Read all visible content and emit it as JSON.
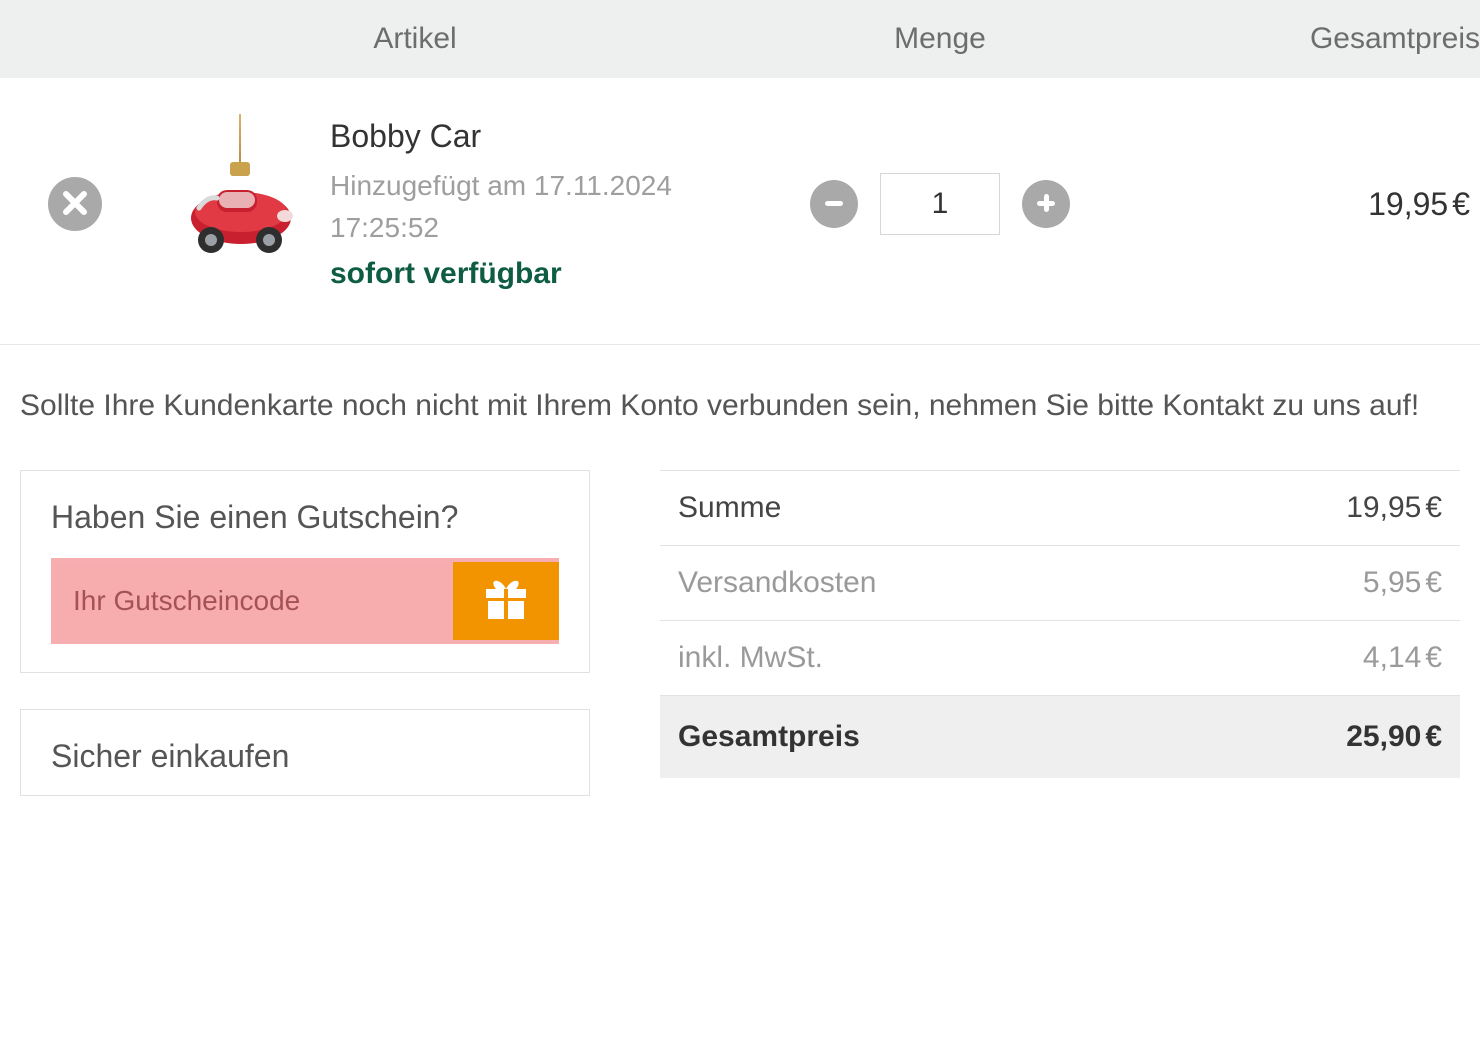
{
  "headers": {
    "article": "Artikel",
    "qty": "Menge",
    "total": "Gesamtpreis"
  },
  "item": {
    "name": "Bobby Car",
    "added_label": "Hinzugefügt am 17.11.2024 17:25:52",
    "availability": "sofort verfügbar",
    "quantity": "1",
    "line_price": "19,95",
    "currency": "€"
  },
  "notice": "Sollte Ihre Kundenkarte noch nicht mit Ihrem Konto verbunden sein, nehmen Sie bitte Kontakt zu uns auf!",
  "coupon": {
    "title": "Haben Sie einen Gutschein?",
    "placeholder": "Ihr Gutscheincode"
  },
  "secure": {
    "title": "Sicher einkaufen"
  },
  "summary": {
    "subtotal_label": "Summe",
    "subtotal_value": "19,95",
    "shipping_label": "Versandkosten",
    "shipping_value": "5,95",
    "vat_label": "inkl. MwSt.",
    "vat_value": "4,14",
    "total_label": "Gesamtpreis",
    "total_value": "25,90",
    "currency": "€"
  }
}
